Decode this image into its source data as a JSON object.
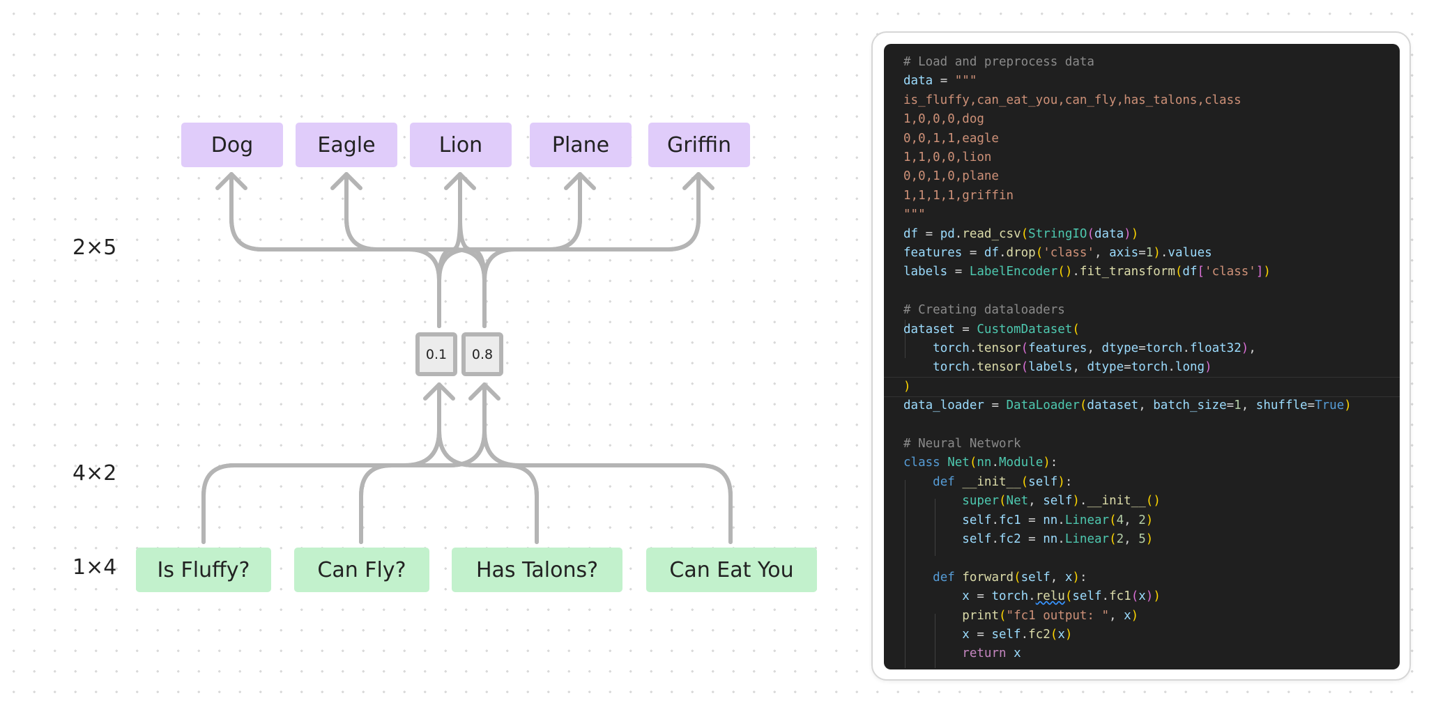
{
  "diagram": {
    "output_classes": [
      "Dog",
      "Eagle",
      "Lion",
      "Plane",
      "Griffin"
    ],
    "input_features": [
      "Is Fluffy?",
      "Can Fly?",
      "Has Talons?",
      "Can Eat You"
    ],
    "hidden_values": [
      "0.1",
      "0.8"
    ],
    "dims": {
      "fc2": "2×5",
      "fc1": "4×2",
      "input": "1×4"
    },
    "colors": {
      "output_box": "#e0ccfa",
      "input_box": "#c2f1cc",
      "wire": "#b4b4b4",
      "hidden_box": "#ececec"
    }
  },
  "code": {
    "lines": [
      [
        [
          "# Load and preprocess data",
          "comment"
        ]
      ],
      [
        [
          "data",
          "var"
        ],
        [
          " = ",
          ""
        ],
        [
          "\"\"\"",
          "str"
        ]
      ],
      [
        [
          "is_fluffy,can_eat_you,can_fly,has_talons,class",
          "str"
        ]
      ],
      [
        [
          "1,0,0,0,dog",
          "str"
        ]
      ],
      [
        [
          "0,0,1,1,eagle",
          "str"
        ]
      ],
      [
        [
          "1,1,0,0,lion",
          "str"
        ]
      ],
      [
        [
          "0,0,1,0,plane",
          "str"
        ]
      ],
      [
        [
          "1,1,1,1,griffin",
          "str"
        ]
      ],
      [
        [
          "\"\"\"",
          "str"
        ]
      ],
      [
        [
          "df",
          "var"
        ],
        [
          " = ",
          ""
        ],
        [
          "pd",
          "var"
        ],
        [
          ".",
          ""
        ],
        [
          "read_csv",
          "fn"
        ],
        [
          "(",
          "br1"
        ],
        [
          "StringIO",
          "cls"
        ],
        [
          "(",
          "br2"
        ],
        [
          "data",
          "var"
        ],
        [
          ")",
          "br2"
        ],
        [
          ")",
          "br1"
        ]
      ],
      [
        [
          "features",
          "var"
        ],
        [
          " = ",
          ""
        ],
        [
          "df",
          "var"
        ],
        [
          ".",
          ""
        ],
        [
          "drop",
          "fn"
        ],
        [
          "(",
          "br1"
        ],
        [
          "'class'",
          "str"
        ],
        [
          ", ",
          ""
        ],
        [
          "axis",
          "var"
        ],
        [
          "=",
          ""
        ],
        [
          "1",
          "num"
        ],
        [
          ")",
          "br1"
        ],
        [
          ".",
          ""
        ],
        [
          "values",
          "var"
        ]
      ],
      [
        [
          "labels",
          "var"
        ],
        [
          " = ",
          ""
        ],
        [
          "LabelEncoder",
          "cls"
        ],
        [
          "(",
          "br1"
        ],
        [
          ")",
          "br1"
        ],
        [
          ".",
          ""
        ],
        [
          "fit_transform",
          "fn"
        ],
        [
          "(",
          "br1"
        ],
        [
          "df",
          "var"
        ],
        [
          "[",
          "br2"
        ],
        [
          "'class'",
          "str"
        ],
        [
          "]",
          "br2"
        ],
        [
          ")",
          "br1"
        ]
      ],
      [],
      [
        [
          "# Creating dataloaders",
          "comment"
        ]
      ],
      [
        [
          "dataset",
          "var"
        ],
        [
          " = ",
          ""
        ],
        [
          "CustomDataset",
          "cls"
        ],
        [
          "(",
          "br1"
        ]
      ],
      [
        [
          "    ",
          ""
        ],
        [
          "torch",
          "var"
        ],
        [
          ".",
          ""
        ],
        [
          "tensor",
          "fn"
        ],
        [
          "(",
          "br2"
        ],
        [
          "features",
          "var"
        ],
        [
          ", ",
          ""
        ],
        [
          "dtype",
          "var"
        ],
        [
          "=",
          ""
        ],
        [
          "torch",
          "var"
        ],
        [
          ".",
          ""
        ],
        [
          "float32",
          "var"
        ],
        [
          ")",
          "br2"
        ],
        [
          ",",
          ""
        ]
      ],
      [
        [
          "    ",
          ""
        ],
        [
          "torch",
          "var"
        ],
        [
          ".",
          ""
        ],
        [
          "tensor",
          "fn"
        ],
        [
          "(",
          "br2"
        ],
        [
          "labels",
          "var"
        ],
        [
          ", ",
          ""
        ],
        [
          "dtype",
          "var"
        ],
        [
          "=",
          ""
        ],
        [
          "torch",
          "var"
        ],
        [
          ".",
          ""
        ],
        [
          "long",
          "var"
        ],
        [
          ")",
          "br2"
        ]
      ],
      [
        [
          ")",
          "br1"
        ]
      ],
      [
        [
          "data_loader",
          "var"
        ],
        [
          " = ",
          ""
        ],
        [
          "DataLoader",
          "cls"
        ],
        [
          "(",
          "br1"
        ],
        [
          "dataset",
          "var"
        ],
        [
          ", ",
          ""
        ],
        [
          "batch_size",
          "var"
        ],
        [
          "=",
          ""
        ],
        [
          "1",
          "num"
        ],
        [
          ", ",
          ""
        ],
        [
          "shuffle",
          "var"
        ],
        [
          "=",
          ""
        ],
        [
          "True",
          "kw"
        ],
        [
          ")",
          "br1"
        ]
      ],
      [],
      [
        [
          "# Neural Network",
          "comment"
        ]
      ],
      [
        [
          "class",
          "kw"
        ],
        [
          " ",
          ""
        ],
        [
          "Net",
          "cls"
        ],
        [
          "(",
          "br1"
        ],
        [
          "nn",
          "cls"
        ],
        [
          ".",
          ""
        ],
        [
          "Module",
          "cls"
        ],
        [
          ")",
          "br1"
        ],
        [
          ":",
          ""
        ]
      ],
      [
        [
          "    ",
          ""
        ],
        [
          "def",
          "kw"
        ],
        [
          " ",
          ""
        ],
        [
          "__init__",
          "fn"
        ],
        [
          "(",
          "br1"
        ],
        [
          "self",
          "var"
        ],
        [
          ")",
          "br1"
        ],
        [
          ":",
          ""
        ]
      ],
      [
        [
          "        ",
          ""
        ],
        [
          "super",
          "cls"
        ],
        [
          "(",
          "br1"
        ],
        [
          "Net",
          "cls"
        ],
        [
          ", ",
          ""
        ],
        [
          "self",
          "var"
        ],
        [
          ")",
          "br1"
        ],
        [
          ".",
          ""
        ],
        [
          "__init__",
          "fn"
        ],
        [
          "(",
          "br1"
        ],
        [
          ")",
          "br1"
        ]
      ],
      [
        [
          "        ",
          ""
        ],
        [
          "self",
          "var"
        ],
        [
          ".",
          ""
        ],
        [
          "fc1",
          "var"
        ],
        [
          " = ",
          ""
        ],
        [
          "nn",
          "var"
        ],
        [
          ".",
          ""
        ],
        [
          "Linear",
          "cls"
        ],
        [
          "(",
          "br1"
        ],
        [
          "4",
          "num"
        ],
        [
          ", ",
          ""
        ],
        [
          "2",
          "num"
        ],
        [
          ")",
          "br1"
        ]
      ],
      [
        [
          "        ",
          ""
        ],
        [
          "self",
          "var"
        ],
        [
          ".",
          ""
        ],
        [
          "fc2",
          "var"
        ],
        [
          " = ",
          ""
        ],
        [
          "nn",
          "var"
        ],
        [
          ".",
          ""
        ],
        [
          "Linear",
          "cls"
        ],
        [
          "(",
          "br1"
        ],
        [
          "2",
          "num"
        ],
        [
          ", ",
          ""
        ],
        [
          "5",
          "num"
        ],
        [
          ")",
          "br1"
        ]
      ],
      [],
      [
        [
          "    ",
          ""
        ],
        [
          "def",
          "kw"
        ],
        [
          " ",
          ""
        ],
        [
          "forward",
          "fn"
        ],
        [
          "(",
          "br1"
        ],
        [
          "self",
          "var"
        ],
        [
          ", ",
          ""
        ],
        [
          "x",
          "var"
        ],
        [
          ")",
          "br1"
        ],
        [
          ":",
          ""
        ]
      ],
      [
        [
          "        ",
          ""
        ],
        [
          "x",
          "var"
        ],
        [
          " = ",
          ""
        ],
        [
          "torch",
          "var"
        ],
        [
          ".",
          ""
        ],
        [
          "relu",
          "fn squiggle"
        ],
        [
          "(",
          "br1"
        ],
        [
          "self",
          "var"
        ],
        [
          ".",
          ""
        ],
        [
          "fc1",
          "fn"
        ],
        [
          "(",
          "br2"
        ],
        [
          "x",
          "var"
        ],
        [
          ")",
          "br2"
        ],
        [
          ")",
          "br1"
        ]
      ],
      [
        [
          "        ",
          ""
        ],
        [
          "print",
          "fn"
        ],
        [
          "(",
          "br1"
        ],
        [
          "\"fc1 output: \"",
          "str"
        ],
        [
          ", ",
          ""
        ],
        [
          "x",
          "var"
        ],
        [
          ")",
          "br1"
        ]
      ],
      [
        [
          "        ",
          ""
        ],
        [
          "x",
          "var"
        ],
        [
          " = ",
          ""
        ],
        [
          "self",
          "var"
        ],
        [
          ".",
          ""
        ],
        [
          "fc2",
          "fn"
        ],
        [
          "(",
          "br1"
        ],
        [
          "x",
          "var"
        ],
        [
          ")",
          "br1"
        ]
      ],
      [
        [
          "        ",
          ""
        ],
        [
          "return",
          "ctrl"
        ],
        [
          " ",
          ""
        ],
        [
          "x",
          "var"
        ]
      ]
    ]
  }
}
